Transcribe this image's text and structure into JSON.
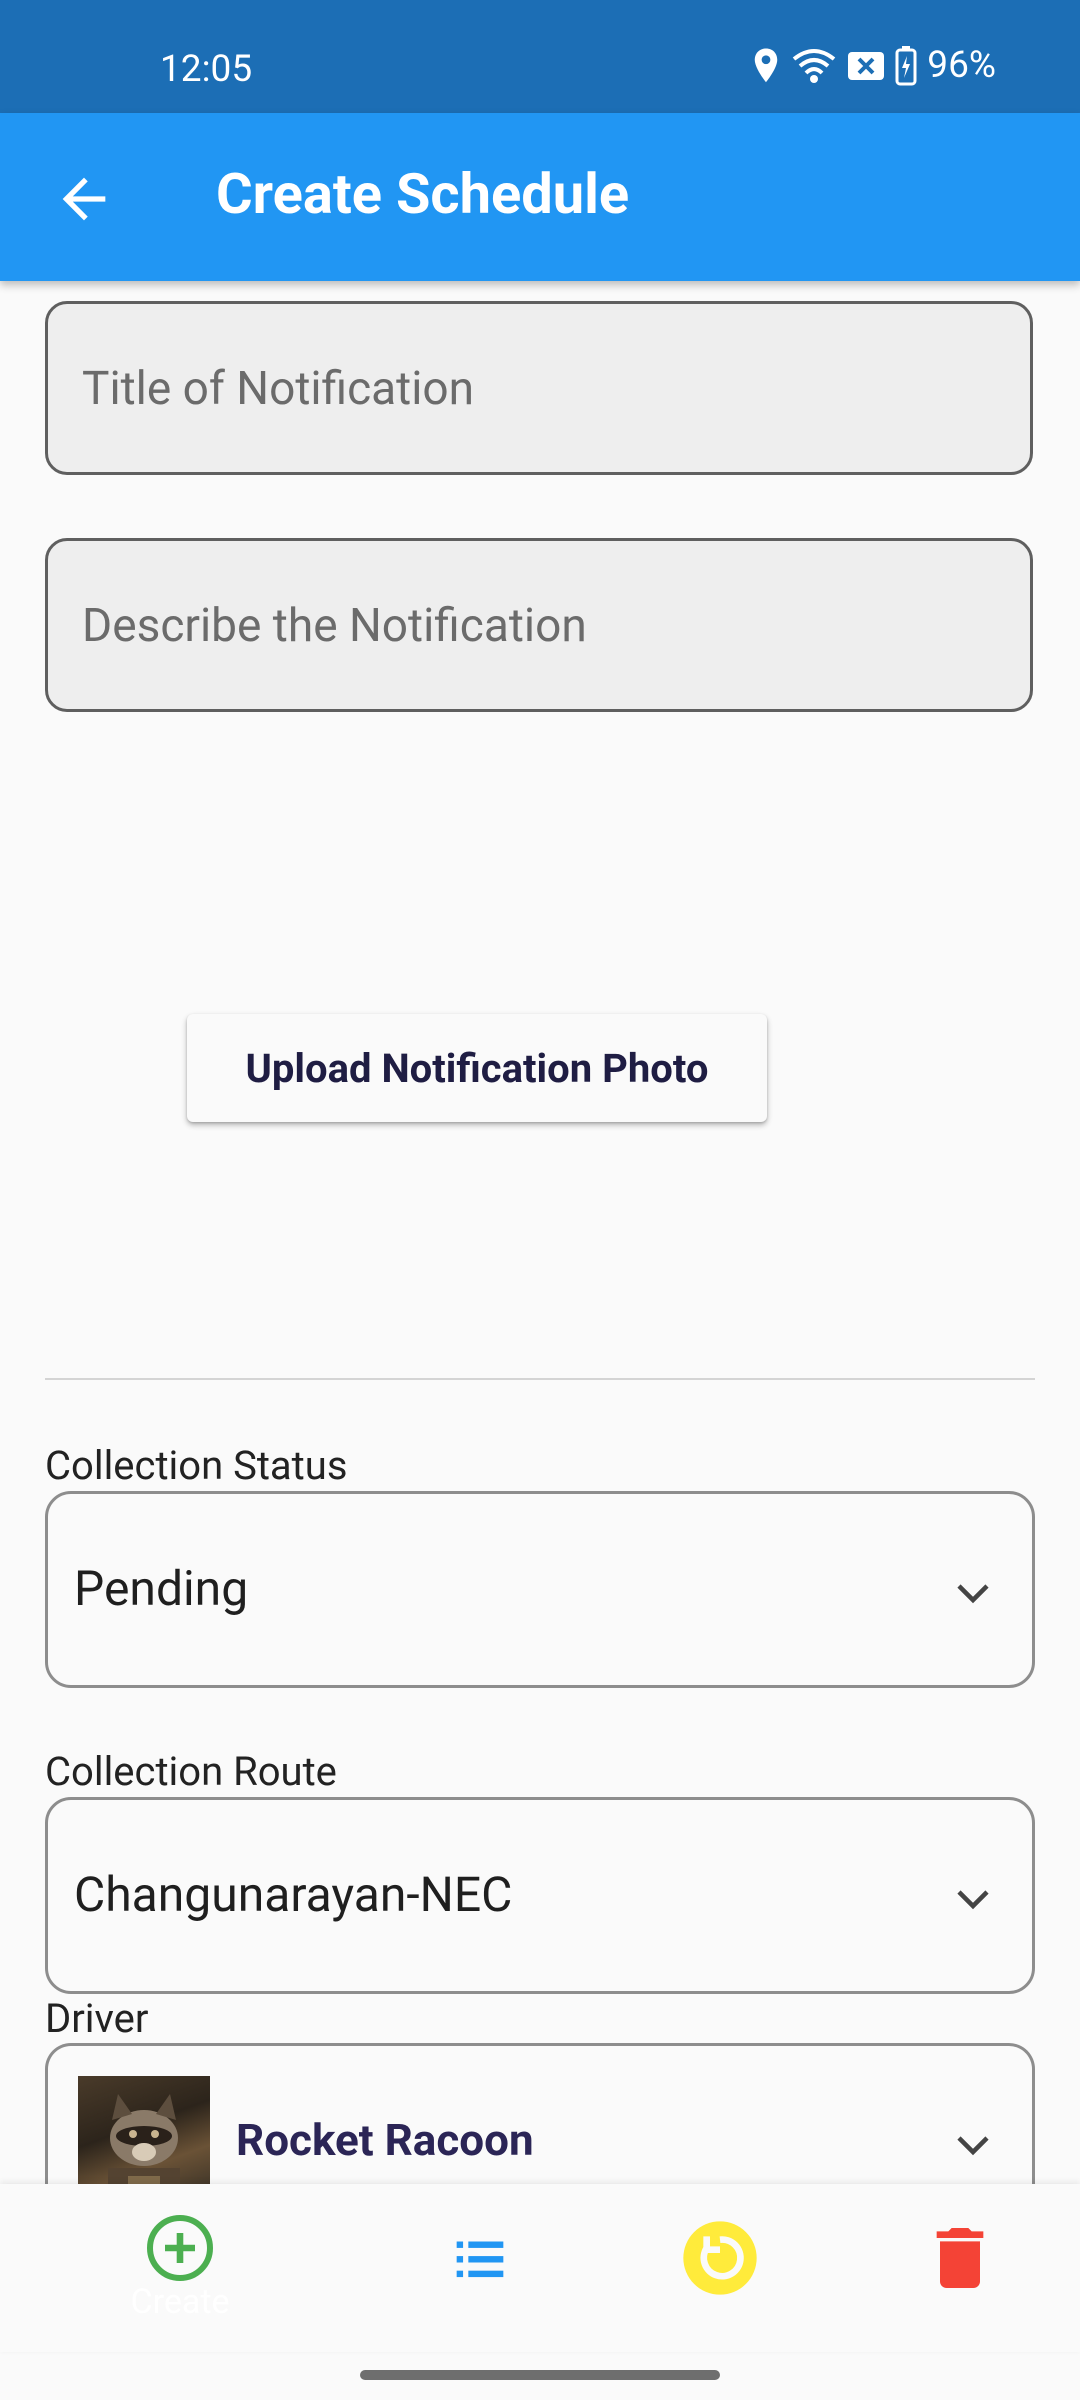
{
  "status_bar": {
    "time": "12:05",
    "battery": "96%"
  },
  "app_bar": {
    "title": "Create Schedule"
  },
  "form": {
    "title_placeholder": "Title of Notification",
    "description_placeholder": "Describe the Notification",
    "upload_label": "Upload Notification Photo"
  },
  "collection_status": {
    "label": "Collection Status",
    "value": "Pending"
  },
  "collection_route": {
    "label": "Collection Route",
    "value": "Changunarayan-NEC"
  },
  "driver": {
    "label": "Driver",
    "name": "Rocket Racoon"
  },
  "bottom_nav": {
    "create_label": "Create",
    "icons": [
      "add-circle-icon",
      "list-icon",
      "refresh-icon",
      "delete-icon"
    ]
  },
  "colors": {
    "status_bar": "#1c6eb5",
    "app_bar": "#2196f3",
    "create": "#4caf50",
    "list": "#2196f3",
    "refresh": "#ffeb3b",
    "delete": "#f44336"
  }
}
